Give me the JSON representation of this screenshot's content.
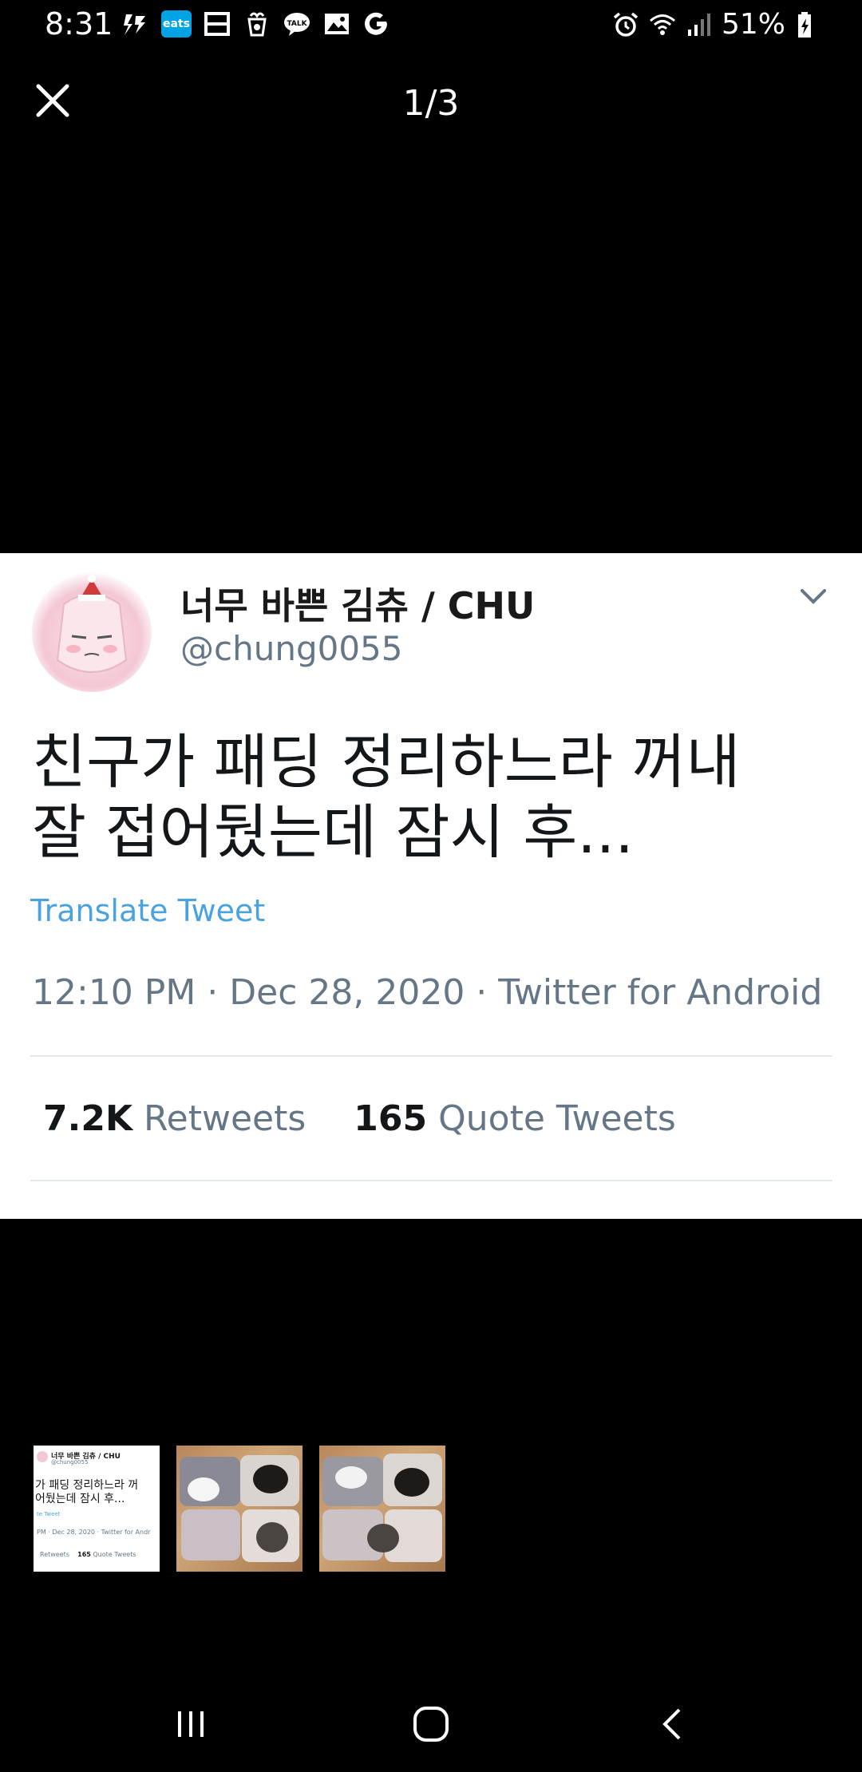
{
  "status_bar": {
    "time": "8:31",
    "eats_label": "eats",
    "battery": "51%",
    "icons_left": [
      "flash-icon",
      "eats-app-icon",
      "calendar-icon",
      "cup-icon",
      "kakaotalk-icon",
      "gallery-icon",
      "google-icon"
    ],
    "icons_right": [
      "alarm-icon",
      "wifi-icon",
      "signal-icon",
      "battery-icon"
    ]
  },
  "viewer": {
    "page_counter": "1/3",
    "current_index": 1,
    "total": 3
  },
  "tweet": {
    "author_name": "너무 바쁜 김츄 / CHU",
    "author_handle": "@chung0055",
    "text_line1": "친구가 패딩 정리하느라 꺼내",
    "text_line2": "잘 접어뒀는데 잠시 후...",
    "translate": "Translate Tweet",
    "meta": "12:10 PM · Dec 28, 2020 · Twitter for Android",
    "retweets_count": "7.2K",
    "retweets_label": "Retweets",
    "quotes_count": "165",
    "quotes_label": "Quote Tweets"
  },
  "thumbnails": {
    "thumb1": {
      "name": "너무 바쁜 김츄 / CHU",
      "handle": "@chung0055",
      "line1": "가 패딩 정리하느라 꺼",
      "line2": "어뒀는데 잠시 후...",
      "translate": "te Tweet",
      "meta": "PM · Dec 28, 2020 · Twitter for Andr",
      "retweets_label": "Retweets",
      "quotes_count": "165",
      "quotes_label": "Quote Tweets"
    }
  },
  "colors": {
    "background": "#000000",
    "card": "#ffffff",
    "link": "#4aa3df",
    "muted": "#657786"
  }
}
